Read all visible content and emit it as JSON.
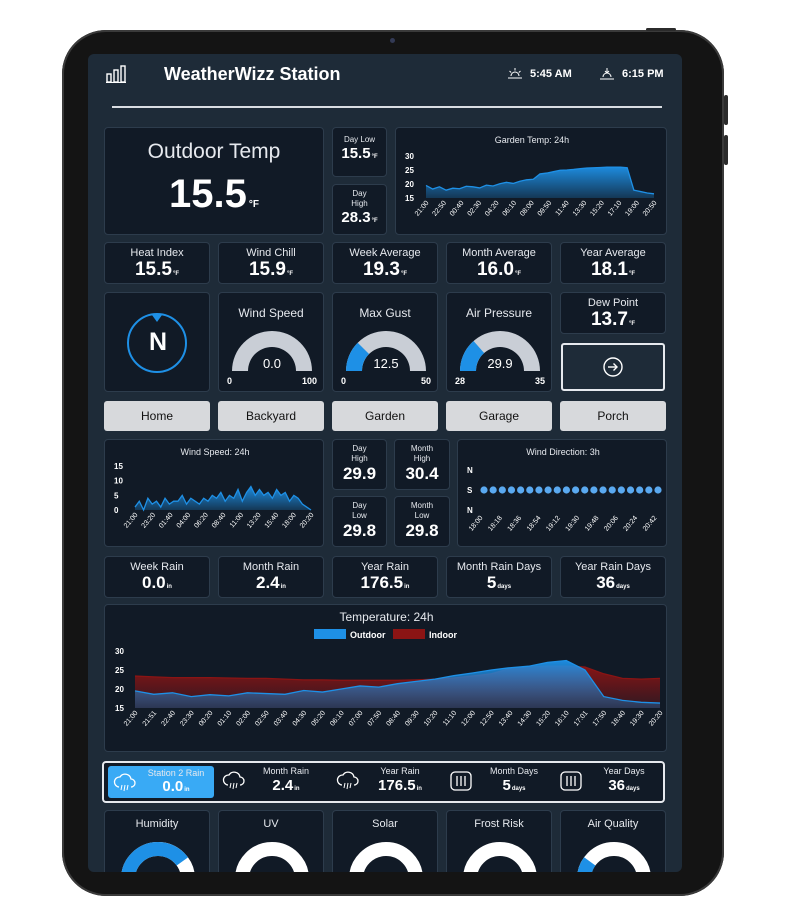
{
  "header": {
    "title": "WeatherWizz Station",
    "sunrise": "5:45 AM",
    "sunset": "6:15 PM"
  },
  "outdoor": {
    "label": "Outdoor Temp",
    "value": "15.5",
    "unit": "°F"
  },
  "day_low": {
    "label": "Day Low",
    "value": "15.5",
    "unit": "°F"
  },
  "day_high": {
    "label_1": "Day",
    "label_2": "High",
    "value": "28.3",
    "unit": "°F"
  },
  "row_temps": [
    {
      "label": "Heat Index",
      "value": "15.5",
      "unit": "°F"
    },
    {
      "label": "Wind Chill",
      "value": "15.9",
      "unit": "°F"
    },
    {
      "label": "Week Average",
      "value": "19.3",
      "unit": "°F"
    },
    {
      "label": "Month Average",
      "value": "16.0",
      "unit": "°F"
    },
    {
      "label": "Year Average",
      "value": "18.1",
      "unit": "°F"
    }
  ],
  "compass": {
    "letter": "N"
  },
  "gauges": [
    {
      "label": "Wind Speed",
      "value": "0.0",
      "min": "0",
      "max": "100",
      "fraction": 0.0
    },
    {
      "label": "Max Gust",
      "value": "12.5",
      "min": "0",
      "max": "50",
      "fraction": 0.25
    },
    {
      "label": "Air Pressure",
      "value": "29.9",
      "min": "28",
      "max": "35",
      "fraction": 0.27
    }
  ],
  "dew_point": {
    "label": "Dew Point",
    "value": "13.7",
    "unit": "°F"
  },
  "locations": [
    "Home",
    "Backyard",
    "Garden",
    "Garage",
    "Porch"
  ],
  "wind_stats": [
    {
      "label_1": "Day",
      "label_2": "High",
      "value": "29.9"
    },
    {
      "label_1": "Month",
      "label_2": "High",
      "value": "30.4"
    },
    {
      "label_1": "Day",
      "label_2": "Low",
      "value": "29.8"
    },
    {
      "label_1": "Month",
      "label_2": "Low",
      "value": "29.8"
    }
  ],
  "rain_row": [
    {
      "label": "Week Rain",
      "value": "0.0",
      "unit": "in"
    },
    {
      "label": "Month Rain",
      "value": "2.4",
      "unit": "in"
    },
    {
      "label": "Year Rain",
      "value": "176.5",
      "unit": "in"
    },
    {
      "label": "Month Rain Days",
      "value": "5",
      "unit": "days"
    },
    {
      "label": "Year Rain Days",
      "value": "36",
      "unit": "days"
    }
  ],
  "rain_bar": {
    "station": {
      "label": "Station 2 Rain",
      "value": "0.0",
      "unit": "in"
    },
    "items": [
      {
        "label": "Month Rain",
        "value": "2.4",
        "unit": "in"
      },
      {
        "label": "Year Rain",
        "value": "176.5",
        "unit": "in"
      },
      {
        "label": "Month Days",
        "value": "5",
        "unit": "days"
      },
      {
        "label": "Year Days",
        "value": "36",
        "unit": "days"
      }
    ]
  },
  "bottom_gauges": [
    {
      "label": "Humidity",
      "fraction": 0.4
    },
    {
      "label": "UV",
      "fraction": 0
    },
    {
      "label": "Solar",
      "fraction": 0
    },
    {
      "label": "Frost Risk",
      "fraction": 0
    },
    {
      "label": "Air Quality",
      "fraction": 0.1
    }
  ],
  "colors": {
    "accent": "#1e90e6",
    "indoor": "#8b1414",
    "card": "#111a26",
    "screen": "#1e2b38"
  },
  "chart_data": [
    {
      "type": "area",
      "title": "Garden Temp: 24h",
      "ylim": [
        15,
        30
      ],
      "yticks": [
        "30",
        "25",
        "20",
        "15"
      ],
      "xticks": [
        "21:00",
        "22:50",
        "00:40",
        "02:30",
        "04:20",
        "06:10",
        "08:00",
        "09:50",
        "11:40",
        "13:30",
        "15:20",
        "17:10",
        "19:00",
        "20:50"
      ],
      "values": [
        19.5,
        18.2,
        19.0,
        17.8,
        18.5,
        18.3,
        19.2,
        19.0,
        18.6,
        19.6,
        19.3,
        20.1,
        20.6,
        20.2,
        21.0,
        21.5,
        21.7,
        23.6,
        23.9,
        24.4,
        24.9,
        25.0,
        25.2,
        25.5,
        25.7,
        25.8,
        25.9,
        26.0,
        26.0,
        26.0,
        25.8,
        17.8,
        17.3,
        16.8,
        16.5
      ]
    },
    {
      "type": "area",
      "title": "Wind Speed: 24h",
      "ylim": [
        0,
        15
      ],
      "yticks": [
        "15",
        "10",
        "5",
        "0"
      ],
      "xticks": [
        "21:00",
        "23:20",
        "01:40",
        "04:00",
        "06:20",
        "08:40",
        "11:00",
        "13:20",
        "15:40",
        "18:00",
        "20:20"
      ],
      "values": [
        1,
        3,
        0,
        4,
        2,
        3,
        1,
        4,
        2,
        3,
        3,
        5,
        2,
        4,
        3,
        2,
        4,
        3,
        5,
        4,
        6,
        3,
        5,
        4,
        7,
        3,
        6,
        8,
        5,
        7,
        5,
        6,
        4,
        7,
        5,
        6,
        3,
        5,
        4,
        2,
        1,
        0
      ]
    },
    {
      "type": "scatter",
      "title": "Wind Direction: 3h",
      "yticks": [
        "N",
        "S",
        "N"
      ],
      "xticks": [
        "18:00",
        "18:18",
        "18:36",
        "18:54",
        "19:12",
        "19:30",
        "19:48",
        "20:06",
        "20:24",
        "20:42"
      ],
      "values": [
        "S",
        "S",
        "S",
        "S",
        "S",
        "S",
        "S",
        "S",
        "S",
        "S",
        "S",
        "S",
        "S",
        "S",
        "S",
        "S",
        "S",
        "S",
        "S",
        "S"
      ]
    },
    {
      "type": "area",
      "title": "Temperature: 24h",
      "ylim": [
        15,
        30
      ],
      "yticks": [
        "30",
        "25",
        "20",
        "15"
      ],
      "legend": [
        "Outdoor",
        "Indoor"
      ],
      "xticks": [
        "21:00",
        "21:51",
        "22:40",
        "23:30",
        "00:20",
        "01:10",
        "02:00",
        "02:50",
        "03:40",
        "04:30",
        "05:20",
        "06:10",
        "07:00",
        "07:50",
        "08:40",
        "09:30",
        "10:20",
        "11:10",
        "12:00",
        "12:50",
        "13:40",
        "14:30",
        "15:20",
        "16:10",
        "17:01",
        "17:50",
        "18:40",
        "19:30",
        "20:20"
      ],
      "series": [
        {
          "name": "Outdoor",
          "values": [
            19.5,
            18.6,
            19.0,
            18.0,
            18.5,
            18.2,
            19.0,
            18.8,
            18.6,
            19.6,
            19.2,
            20.0,
            20.8,
            20.5,
            21.4,
            22.0,
            22.6,
            23.5,
            24.2,
            25.0,
            25.6,
            26.0,
            27.0,
            27.5,
            25.0,
            18.0,
            17.0,
            16.5,
            16.3
          ]
        },
        {
          "name": "Indoor",
          "values": [
            23.4,
            23.2,
            23.0,
            23.0,
            23.0,
            22.9,
            22.8,
            22.8,
            22.6,
            22.4,
            22.4,
            22.3,
            22.3,
            22.3,
            22.3,
            22.4,
            22.6,
            22.9,
            23.4,
            24.0,
            25.4,
            25.8,
            26.0,
            26.0,
            25.8,
            24.0,
            22.8,
            22.6,
            22.8
          ]
        }
      ]
    }
  ]
}
